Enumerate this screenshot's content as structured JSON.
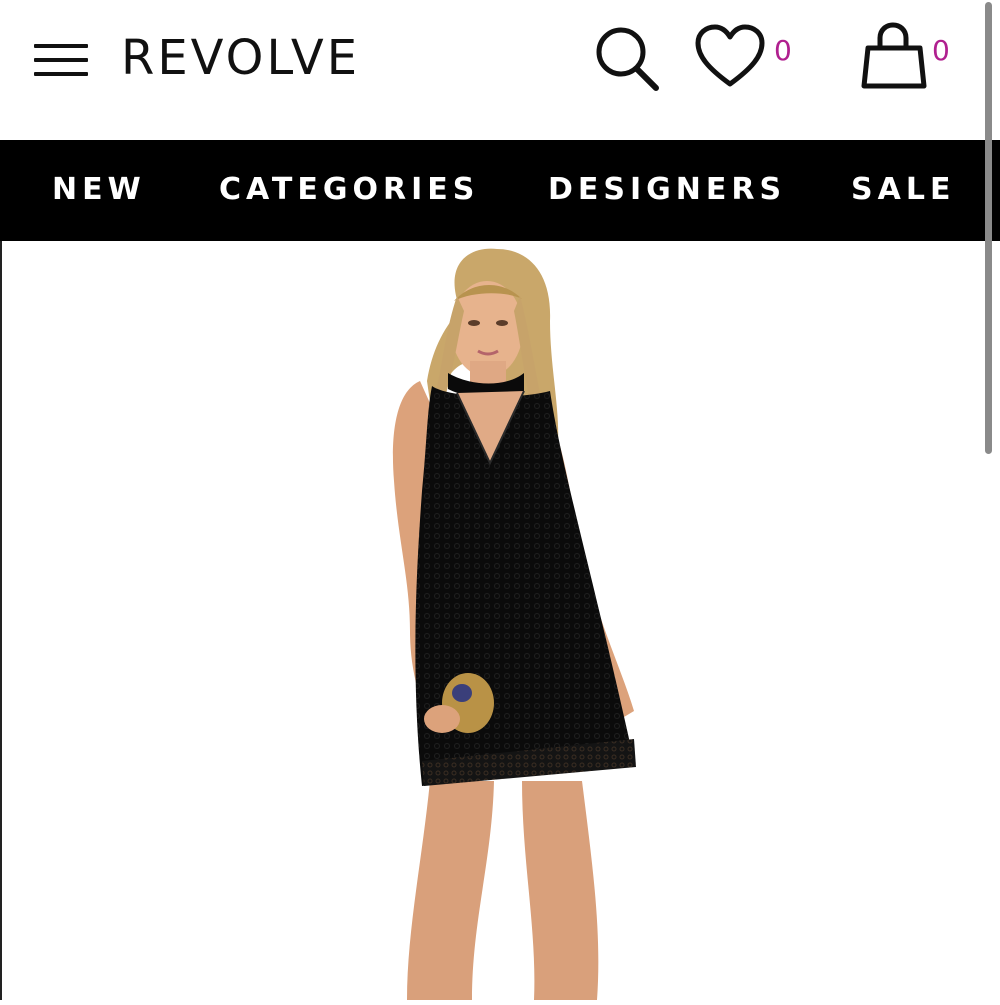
{
  "header": {
    "logo": "REVOLVE",
    "menu_icon": "hamburger-menu-icon",
    "search_icon": "search-icon",
    "wishlist": {
      "icon": "heart-icon",
      "count": "0"
    },
    "bag": {
      "icon": "shopping-bag-icon",
      "count": "0"
    },
    "count_color": "#b0208f"
  },
  "nav": {
    "items": [
      {
        "label": "NEW"
      },
      {
        "label": "CATEGORIES"
      },
      {
        "label": "DESIGNERS"
      },
      {
        "label": "SALE"
      }
    ],
    "background": "#000000",
    "text_color": "#ffffff"
  },
  "product": {
    "image_subject": "model-in-black-lace-choker-shift-dress"
  }
}
